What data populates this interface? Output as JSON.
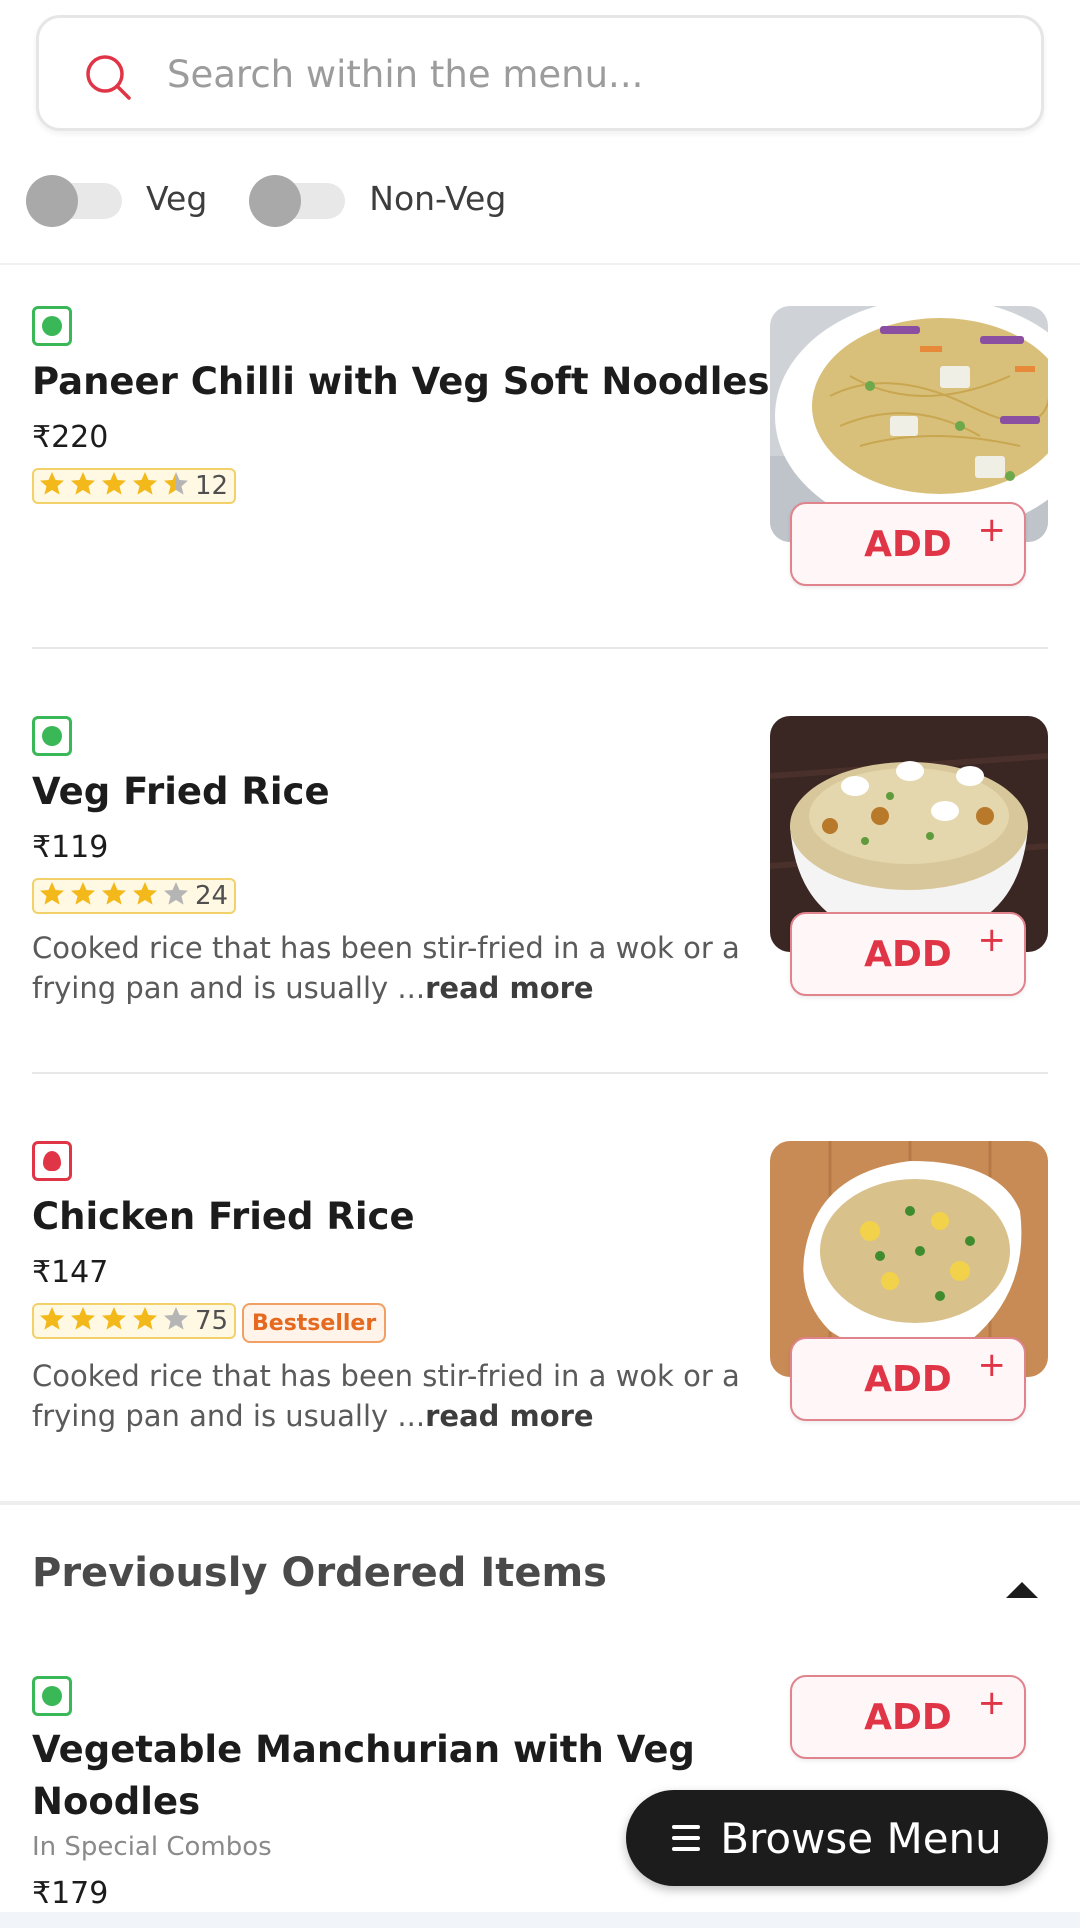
{
  "search": {
    "placeholder": "Search within the menu..."
  },
  "filters": [
    {
      "label": "Veg",
      "on": false
    },
    {
      "label": "Non-Veg",
      "on": false
    }
  ],
  "items": [
    {
      "name": "Paneer Chilli with Veg Soft Noodles",
      "price": "₹220",
      "type": "veg",
      "rating": 4.5,
      "rating_count": "12",
      "badge": "",
      "description": "",
      "add_label": "ADD",
      "add_plus": "+"
    },
    {
      "name": "Veg Fried Rice",
      "price": "₹119",
      "type": "veg",
      "rating": 4,
      "rating_count": "24",
      "badge": "",
      "description": "Cooked rice that has been stir-fried in a wok or a frying pan and is usually ...",
      "read_more": "read more",
      "add_label": "ADD",
      "add_plus": "+"
    },
    {
      "name": "Chicken Fried Rice",
      "price": "₹147",
      "type": "non-veg",
      "rating": 4,
      "rating_count": "75",
      "badge": "Bestseller",
      "description": "Cooked rice that has been stir-fried in a wok or a frying pan and is usually ...",
      "read_more": "read more",
      "add_label": "ADD",
      "add_plus": "+"
    }
  ],
  "previously_ordered": {
    "title": "Previously Ordered Items",
    "items": [
      {
        "name_line1": "Vegetable Manchurian with Veg",
        "name_line2": "Noodles",
        "category": "In Special Combos",
        "price": "₹179",
        "type": "veg",
        "add_label": "ADD",
        "add_plus": "+"
      }
    ]
  },
  "browse_menu": {
    "label": "Browse Menu"
  },
  "colors": {
    "accent": "#e03546",
    "veg": "#3ab757",
    "star": "#f3b81a",
    "star_empty": "#b5b5b5",
    "bestseller": "#e56a1f"
  },
  "icons": [
    "search-icon",
    "veg-indicator-icon",
    "non-veg-indicator-icon",
    "star-icon",
    "collapse-caret-icon",
    "hamburger-menu-icon"
  ]
}
